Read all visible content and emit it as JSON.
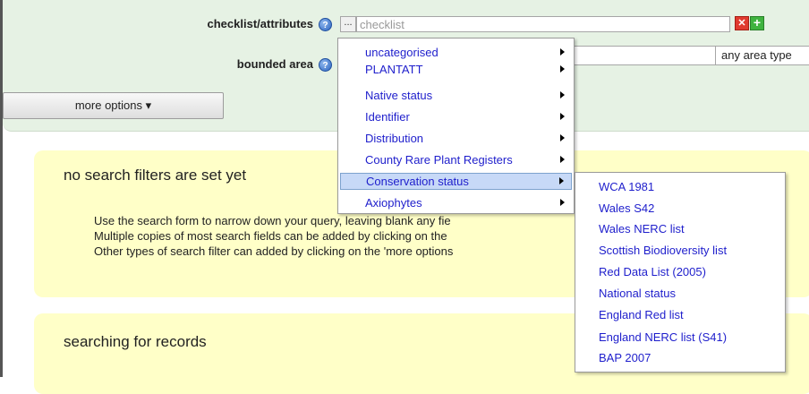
{
  "form": {
    "checklist_label": "checklist/attributes",
    "checklist_placeholder": "checklist",
    "dots_label": "...",
    "remove_label": "✕",
    "add_label": "+",
    "area_label": "bounded area",
    "area_type_value": "any area type",
    "more_options_label": "more options ▾",
    "help_glyph": "?"
  },
  "messages": {
    "filters_heading": "no search filters are set yet",
    "filters_lines": [
      "Use the search form to narrow down your query, leaving blank any fie",
      "Multiple copies of most search fields can be added by clicking on the",
      "Other types of search filter can added by clicking on the 'more options"
    ],
    "records_heading": "searching for records"
  },
  "menu": {
    "items": [
      {
        "label": "uncategorised"
      },
      {
        "label": "PLANTATT"
      },
      {
        "label": "Native status"
      },
      {
        "label": "Identifier"
      },
      {
        "label": "Distribution"
      },
      {
        "label": "County Rare Plant Registers"
      },
      {
        "label": "Conservation status"
      },
      {
        "label": "Axiophytes"
      }
    ],
    "active_item": "Conservation status",
    "submenu": [
      {
        "label": "WCA 1981"
      },
      {
        "label": "Wales S42"
      },
      {
        "label": "Wales NERC list"
      },
      {
        "label": "Scottish Biodioversity list"
      },
      {
        "label": "Red Data List (2005)"
      },
      {
        "label": "National status"
      },
      {
        "label": "England Red list"
      },
      {
        "label": "England NERC list (S41)"
      },
      {
        "label": "BAP 2007"
      }
    ]
  },
  "colors": {
    "form_background": "#e6f2e4",
    "message_background": "#ffffc8",
    "menu_link": "#1e1ecc",
    "menu_highlight": "#c7d9f7"
  },
  "icons": {
    "help": "help-icon",
    "remove": "remove-icon",
    "add": "add-icon",
    "submenu": "submenu-arrow-icon"
  }
}
